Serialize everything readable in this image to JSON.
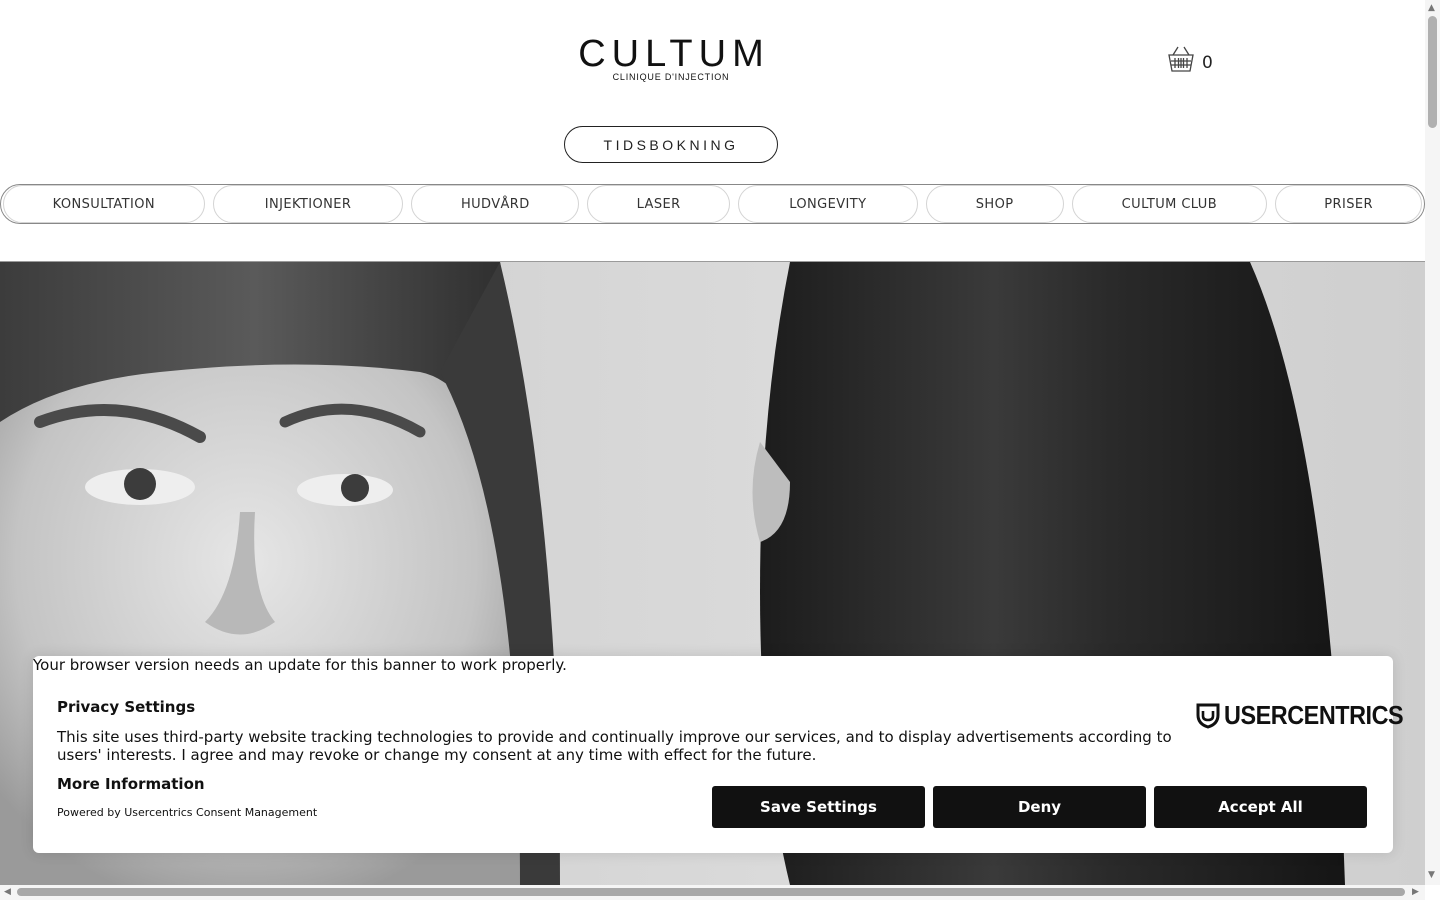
{
  "header": {
    "logo_main": "CULTUM",
    "logo_sub": "CLINIQUE D'INJECTION",
    "cart_icon": "basket-icon",
    "cart_count": "0",
    "booking_label": "TIDSBOKNING"
  },
  "nav": {
    "items": [
      {
        "label": "KONSULTATION"
      },
      {
        "label": "INJEKTIONER"
      },
      {
        "label": "HUDVÅRD"
      },
      {
        "label": "LASER"
      },
      {
        "label": "LONGEVITY"
      },
      {
        "label": "SHOP"
      },
      {
        "label": "CULTUM CLUB"
      },
      {
        "label": "PRISER"
      }
    ]
  },
  "hero": {
    "image": "black-and-white photo of two women with long dark hair and bangs"
  },
  "consent": {
    "browser_warning": "Your browser version needs an update for this banner to work properly.",
    "title": "Privacy Settings",
    "text": "This site uses third-party website tracking technologies to provide and continually improve our services, and to display advertisements according to users' interests. I agree and may revoke or change my consent at any time with effect for the future.",
    "more_info": "More Information",
    "powered_by": "Powered by Usercentrics Consent Management",
    "brand": "USERCENTRICS",
    "buttons": {
      "save": "Save Settings",
      "deny": "Deny",
      "accept": "Accept All"
    }
  },
  "colors": {
    "button_bg": "#111111",
    "border": "#222222"
  }
}
